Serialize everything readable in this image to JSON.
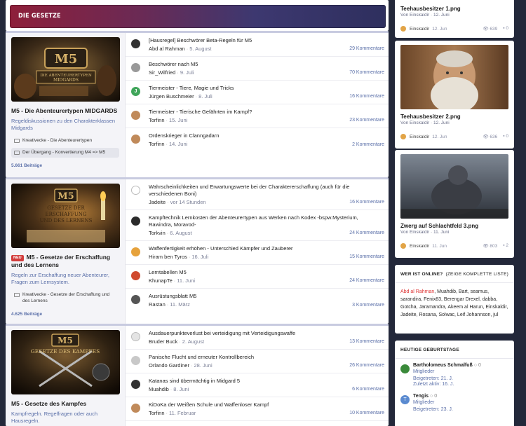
{
  "header": {
    "title": "DIE GESETZE"
  },
  "forums": [
    {
      "title": "M5 - Die Abenteurertypen MIDGARDS",
      "badge": "",
      "description": "Regeldiskussionen zu den Charakterklassen Midgards",
      "subforums": [
        "Kreativecke - Die Abenteurertypen",
        "Der Übergang - Konvertierung M4 => M5"
      ],
      "posts": "5.661 Beiträge",
      "image_text": [
        "M5",
        "DIE ABENTEURERTYPEN",
        "MIDGARDS"
      ],
      "threads": [
        {
          "title": "[Hausregel] Beschwörer Beta-Regeln für M5",
          "author": "Abd al Rahman",
          "date": "5. August",
          "comments": "29 Kommentare",
          "avatar": "#333"
        },
        {
          "title": "Beschwörer nach M5",
          "author": "Sir_Wilfried",
          "date": "9. Juli",
          "comments": "70 Kommentare",
          "avatar": "#999"
        },
        {
          "title": "Tiermeister - Tiere, Magie und Tricks",
          "author": "Jürgen Buschmeier",
          "date": "8. Juli",
          "comments": "16 Kommentare",
          "avatar": "#3fa55a"
        },
        {
          "title": "Tiermeister - Tierische Gefährten im Kampf?",
          "author": "Torfinn",
          "date": "15. Juni",
          "comments": "23 Kommentare",
          "avatar": "#c08a5a"
        },
        {
          "title": "Ordenskrieger in Clanngadarn",
          "author": "Torfinn",
          "date": "14. Juni",
          "comments": "2 Kommentare",
          "avatar": "#c08a5a"
        }
      ]
    },
    {
      "title": "M5 - Gesetze der Erschaffung und des Lernens",
      "badge": "NEU",
      "description": "Regeln zur Erschaffung neuer Abenteurer, Fragen zum Lernsystem.",
      "subforums": [
        "Kreativecke - Gesetze der Erschaffung und des Lernens"
      ],
      "posts": "4.625 Beiträge",
      "image_text": [
        "M5",
        "GESETZE DER",
        "ERSCHAFFUNG",
        "UND DES LERNENS"
      ],
      "threads": [
        {
          "title": "Wahrscheinlichkeiten und Erwartungswerte bei der Charaktererschaffung (auch für die verschiedenen Boni)",
          "author": "Jadeite",
          "date": "vor 14 Stunden",
          "comments": "16 Kommentare",
          "avatar": "#e8e8e8",
          "tall": true
        },
        {
          "title": "Kampftechnik Lernkosten der Abenteurertypen aus Werken nach Kodex -bspw.Mysterium, Rawindra, Moravod-",
          "author": "Torkvin",
          "date": "6. August",
          "comments": "24 Kommentare",
          "avatar": "#2b2b2b",
          "tall": true
        },
        {
          "title": "Waffenfertigkeit erhöhen - Unterschied Kämpfer und Zauberer",
          "author": "Hiram ben Tyros",
          "date": "16. Juli",
          "comments": "15 Kommentare",
          "avatar": "#e6a23c"
        },
        {
          "title": "Lerntabellen M5",
          "author": "KhunapTe",
          "date": "11. Juni",
          "comments": "24 Kommentare",
          "avatar": "#d04a2e"
        },
        {
          "title": "Ausrüstungsblatt M5",
          "author": "Rastan",
          "date": "11. März",
          "comments": "3 Kommentare",
          "avatar": "#555"
        }
      ]
    },
    {
      "title": "M5 - Gesetze des Kampfes",
      "badge": "",
      "description": "Kampfregeln. Regelfragen oder auch Hausregeln.",
      "subforums": [],
      "posts": "",
      "image_text": [
        "M5",
        "GESETZE DES KAMPFES"
      ],
      "threads": [
        {
          "title": "Ausdauerpunkteverlust bei verteidigung mit Verteidigungswaffe",
          "author": "Bruder Buck",
          "date": "2. August",
          "comments": "13 Kommentare",
          "avatar": "#ddd"
        },
        {
          "title": "Panische Flucht und erneuter Kontrollbereich",
          "author": "Orlando Gardiner",
          "date": "28. Juni",
          "comments": "26 Kommentare",
          "avatar": "#c8c8c8"
        },
        {
          "title": "Katanas sind übermächtig in Midgard 5",
          "author": "Muahdib",
          "date": "8. Juni",
          "comments": "6 Kommentare",
          "avatar": "#333"
        },
        {
          "title": "KiDoKa der Weißen Schule und Waffenloser Kampf",
          "author": "Torfinn",
          "date": "11. Februar",
          "comments": "10 Kommentare",
          "avatar": "#c08a5a"
        }
      ]
    }
  ],
  "gallery": [
    {
      "title": "Teehausbesitzer 1.png",
      "sub": "Von Einskaldir · 12. Juni",
      "author": "Einskaldir",
      "date": "12. Jun",
      "views": "639",
      "comments": "0"
    },
    {
      "title": "Teehausbesitzer 2.png",
      "sub": "Von Einskaldir · 12. Juni",
      "author": "Einskaldir",
      "date": "12. Jun",
      "views": "636",
      "comments": "0"
    },
    {
      "title": "Zwerg auf Schlachtfeld 3.png",
      "sub": "Von Einskaldir · 11. Juni",
      "author": "Einskaldir",
      "date": "11. Jun",
      "views": "803",
      "comments": "2"
    }
  ],
  "online": {
    "title": "WER IST ONLINE?",
    "link": "(ZEIGE KOMPLETTE LISTE)",
    "admin": "Abd al Rahman",
    "users": ", Muahdib, Bart, seamus, sarandira, Fenix83, Berengar Drexel, dabba, Gotcha, Jaramandra, Akeem al Harun, Einskaldir, Jadeite, Rosana, Solwac, Leif Johannson, jul"
  },
  "birthdays": {
    "title": "HEUTIGE GEBURTSTAGE",
    "people": [
      {
        "name": "Bartholomeus Schmalfuß",
        "count": "0",
        "role": "Mitglieder",
        "joined": "Beigetreten: 21. J.",
        "active": "Zuletzt aktiv: 16. J."
      },
      {
        "name": "Tengis",
        "count": "0",
        "role": "Mitglieder",
        "joined": "Beigetreten: 23. J."
      }
    ]
  },
  "colors": {
    "accent": "#5a6fa8",
    "background": "#23283a",
    "admin": "#dd3333"
  }
}
